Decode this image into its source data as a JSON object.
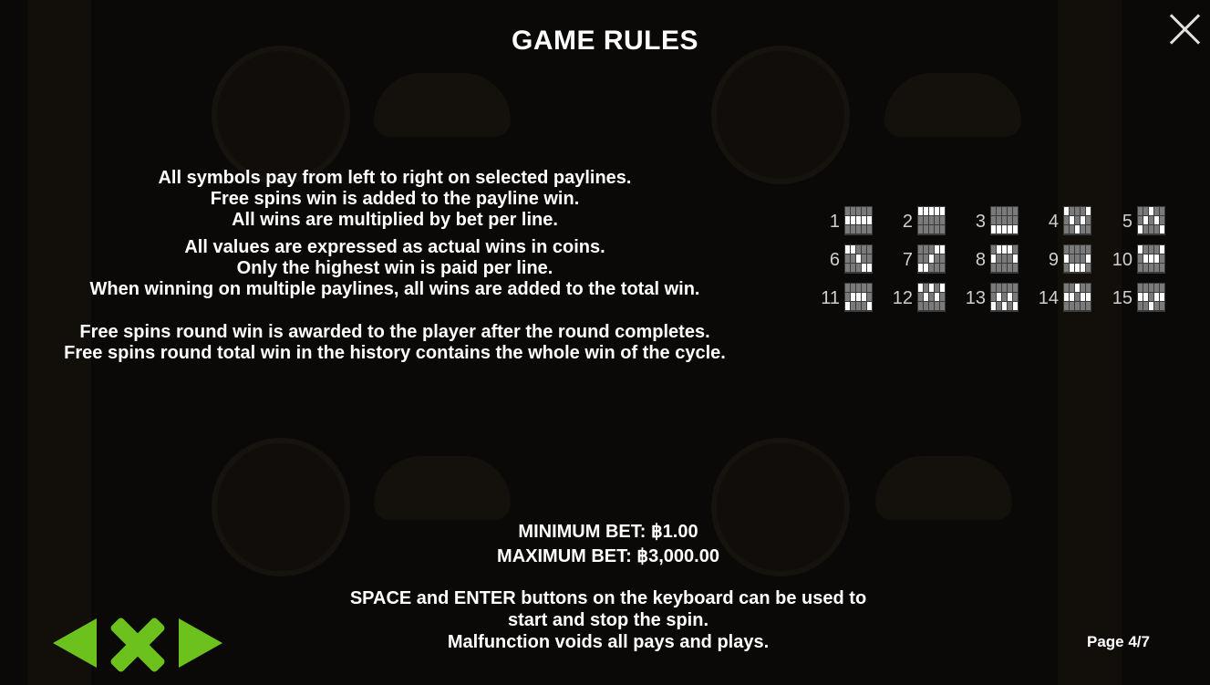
{
  "title": "GAME RULES",
  "rules_group_1": [
    "All symbols pay from left to right on selected paylines.",
    "Free spins win is added to the payline win.",
    "All wins are multiplied by bet per line."
  ],
  "rules_group_2": [
    "All values are expressed as actual wins in coins.",
    "Only the highest win is paid per line.",
    "When winning on multiple paylines, all wins are added to the total win."
  ],
  "rules_group_3": [
    "Free spins round win is awarded to the player after the round completes.",
    "Free spins round total win in the history contains the whole win of the cycle."
  ],
  "paylines": [
    {
      "number": "1",
      "rows": [
        1,
        1,
        1,
        1,
        1
      ]
    },
    {
      "number": "2",
      "rows": [
        0,
        0,
        0,
        0,
        0
      ]
    },
    {
      "number": "3",
      "rows": [
        2,
        2,
        2,
        2,
        2
      ]
    },
    {
      "number": "4",
      "rows": [
        0,
        1,
        2,
        1,
        0
      ]
    },
    {
      "number": "5",
      "rows": [
        2,
        1,
        0,
        1,
        2
      ]
    },
    {
      "number": "6",
      "rows": [
        0,
        0,
        1,
        2,
        2
      ]
    },
    {
      "number": "7",
      "rows": [
        2,
        2,
        1,
        0,
        0
      ]
    },
    {
      "number": "8",
      "rows": [
        1,
        0,
        0,
        0,
        1
      ]
    },
    {
      "number": "9",
      "rows": [
        1,
        2,
        2,
        2,
        1
      ]
    },
    {
      "number": "10",
      "rows": [
        0,
        1,
        1,
        1,
        0
      ]
    },
    {
      "number": "11",
      "rows": [
        2,
        1,
        1,
        1,
        2
      ]
    },
    {
      "number": "12",
      "rows": [
        0,
        1,
        0,
        1,
        0
      ]
    },
    {
      "number": "13",
      "rows": [
        2,
        1,
        2,
        1,
        2
      ]
    },
    {
      "number": "14",
      "rows": [
        1,
        1,
        0,
        1,
        1
      ]
    },
    {
      "number": "15",
      "rows": [
        1,
        1,
        2,
        1,
        1
      ]
    }
  ],
  "min_bet": "MINIMUM BET: ฿1.00",
  "max_bet": "MAXIMUM BET: ฿3,000.00",
  "notes": [
    "SPACE and ENTER buttons on the keyboard can be used to",
    "start and stop the spin.",
    "Malfunction voids all pays and plays."
  ],
  "page_indicator": "Page 4/7",
  "icons": {
    "close": "close-icon",
    "prev": "arrow-left-icon",
    "exit": "x-icon",
    "next": "arrow-right-icon"
  },
  "colors": {
    "accent": "#6cc11d",
    "background": "#0b0907",
    "text": "#ffffff"
  }
}
